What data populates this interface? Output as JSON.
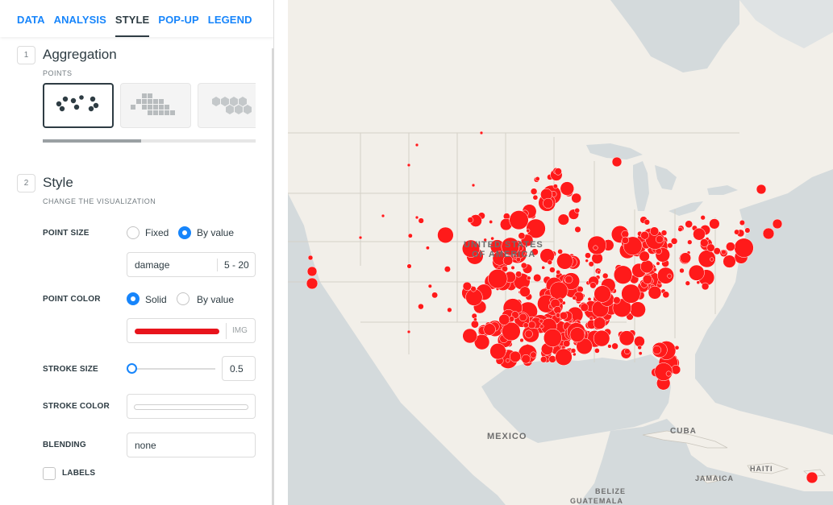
{
  "tabs": [
    {
      "label": "DATA",
      "active": false
    },
    {
      "label": "ANALYSIS",
      "active": false
    },
    {
      "label": "STYLE",
      "active": true
    },
    {
      "label": "POP-UP",
      "active": false
    },
    {
      "label": "LEGEND",
      "active": false
    }
  ],
  "aggregation": {
    "number": "1",
    "title": "Aggregation",
    "subtitle": "POINTS",
    "selected_option": "points-icon"
  },
  "style": {
    "number": "2",
    "title": "Style",
    "subtitle": "CHANGE THE VISUALIZATION",
    "point_size": {
      "label": "POINT SIZE",
      "options": [
        "Fixed",
        "By value"
      ],
      "selected": "By value",
      "column": "damage",
      "range": "5 - 20"
    },
    "point_color": {
      "label": "POINT COLOR",
      "options": [
        "Solid",
        "By value"
      ],
      "selected": "Solid",
      "color": "#e8141c",
      "img_label": "IMG"
    },
    "stroke_size": {
      "label": "STROKE SIZE",
      "value": "0.5"
    },
    "stroke_color": {
      "label": "STROKE COLOR"
    },
    "blending": {
      "label": "BLENDING",
      "value": "none"
    },
    "labels": {
      "label": "LABELS",
      "checked": false
    }
  },
  "map": {
    "labels": {
      "usa_line1": "UNITED STATES",
      "usa_line2": "OF AMERICA",
      "mexico": "MEXICO",
      "cuba": "CUBA",
      "haiti": "HAITI",
      "jamaica": "JAMAICA",
      "belize": "BELIZE",
      "guatemala": "GUATEMALA"
    },
    "point_color": "#ff1a1a",
    "land_color": "#f2efe9",
    "water_color": "#d4dadc"
  }
}
